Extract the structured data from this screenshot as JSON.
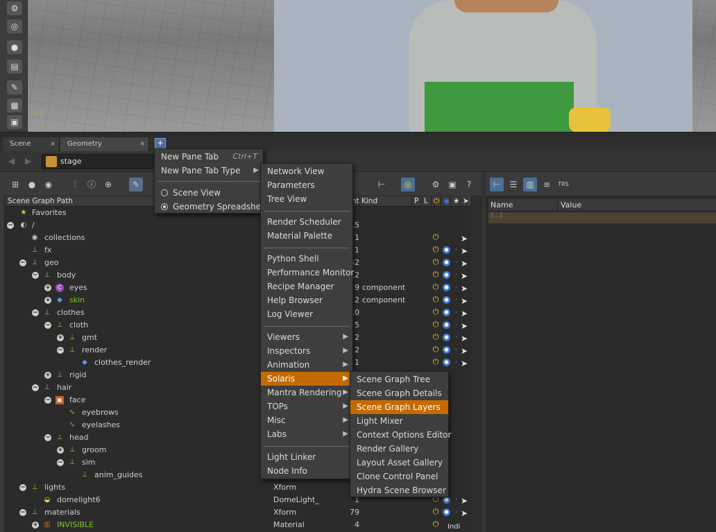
{
  "tabs": {
    "scene_view": "Scene View",
    "geometry_spreadsheet": "Geometry Spreadsheet",
    "add": "+"
  },
  "address": {
    "path": "stage"
  },
  "tree_header": {
    "path": "Scene Graph Path",
    "count": "nt",
    "kind": "Kind",
    "p": "P",
    "l": "L"
  },
  "favorites": "Favorites",
  "tree_rows": [
    {
      "name": "/",
      "col3": ".5"
    },
    {
      "name": "collections",
      "col3": "1"
    },
    {
      "name": "fx",
      "col3": "1"
    },
    {
      "name": "geo",
      "col3": "32"
    },
    {
      "name": "body",
      "col3": ".2"
    },
    {
      "name": "eyes",
      "col3": "9",
      "kind": "component"
    },
    {
      "name": "skin",
      "col3": "2",
      "kind": "component"
    },
    {
      "name": "clothes",
      "col3": ".0"
    },
    {
      "name": "cloth",
      "col3": "5"
    },
    {
      "name": "gmt",
      "col3": "2"
    },
    {
      "name": "render",
      "col3": "2"
    },
    {
      "name": "clothes_render",
      "col3": "1"
    },
    {
      "name": "rigid"
    },
    {
      "name": "hair"
    },
    {
      "name": "face"
    },
    {
      "name": "eyebrows"
    },
    {
      "name": "eyelashes"
    },
    {
      "name": "head"
    },
    {
      "name": "groom"
    },
    {
      "name": "sim"
    },
    {
      "name": "anim_guides"
    },
    {
      "name": "lights",
      "type": "Xform"
    },
    {
      "name": "domelight6",
      "type": "DomeLight_",
      "col3": "1"
    },
    {
      "name": "materials",
      "type": "Xform",
      "col3": "79"
    },
    {
      "name": "INVISIBLE",
      "type": "Material",
      "col3": "4"
    }
  ],
  "bottom_label": "Indi",
  "right_panel": {
    "name_header": "Name",
    "value_header": "Value",
    "selected_row": "[...]"
  },
  "pane_menu": {
    "new_pane_tab": "New Pane Tab",
    "new_pane_tab_shortcut": "Ctrl+T",
    "new_pane_tab_type": "New Pane Tab Type",
    "scene_view": "Scene View",
    "geometry_spreadsheet": "Geometry Spreadsheet"
  },
  "type_menu": {
    "group1": [
      "Network View",
      "Parameters",
      "Tree View"
    ],
    "group2": [
      "Render Scheduler",
      "Material Palette"
    ],
    "group3": [
      "Python Shell",
      "Performance Monitor",
      "Recipe Manager",
      "Help Browser",
      "Log Viewer"
    ],
    "group4": [
      "Viewers",
      "Inspectors",
      "Animation",
      "Solaris",
      "Mantra Rendering",
      "TOPs",
      "Misc",
      "Labs"
    ],
    "group5": [
      "Light Linker",
      "Node Info"
    ]
  },
  "solaris_menu": [
    "Scene Graph Tree",
    "Scene Graph Details",
    "Scene Graph Layers",
    "Light Mixer",
    "Context Options Editor",
    "Render Gallery",
    "Layout Asset Gallery",
    "Clone Control Panel",
    "Hydra Scene Browser"
  ],
  "colors": {
    "menu_highlight": "#c46a00",
    "power_icon": "#f3d132",
    "green_text": "#7ec832"
  }
}
